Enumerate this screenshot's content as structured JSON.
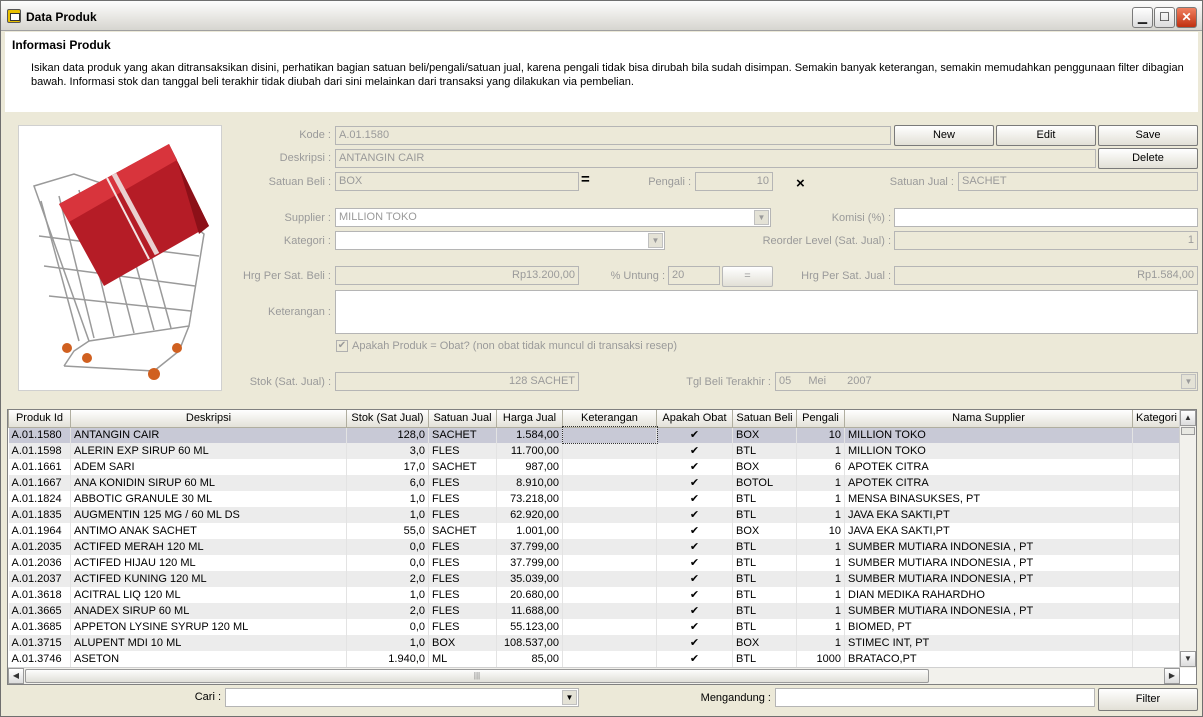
{
  "window": {
    "title": "Data Produk"
  },
  "header": {
    "title": "Informasi Produk",
    "description": "Isikan data produk yang akan ditransaksikan disini, perhatikan bagian satuan beli/pengali/satuan jual, karena pengali tidak bisa dirubah bila sudah disimpan. Semakin banyak keterangan, semakin memudahkan penggunaan filter dibagian bawah. Informasi stok dan tanggal beli terakhir tidak diubah dari sini melainkan dari transaksi yang dilakukan via pembelian."
  },
  "form": {
    "kode_label": "Kode :",
    "kode": "A.01.1580",
    "deskripsi_label": "Deskripsi :",
    "deskripsi": "ANTANGIN CAIR",
    "satuan_beli_label": "Satuan Beli :",
    "satuan_beli": "BOX",
    "equals": "=",
    "pengali_label": "Pengali :",
    "pengali": "10",
    "times": "×",
    "satuan_jual_label": "Satuan Jual :",
    "satuan_jual": "SACHET",
    "supplier_label": "Supplier :",
    "supplier": "MILLION TOKO",
    "komisi_label": "Komisi (%) :",
    "komisi": "",
    "kategori_label": "Kategori :",
    "kategori": "",
    "reorder_label": "Reorder Level (Sat. Jual) :",
    "reorder": "1",
    "hrg_beli_label": "Hrg Per Sat. Beli :",
    "hrg_beli": "Rp13.200,00",
    "untung_label": "% Untung :",
    "untung": "20",
    "calc_label": "=",
    "hrg_jual_label": "Hrg Per Sat. Jual :",
    "hrg_jual": "Rp1.584,00",
    "keterangan_label": "Keterangan :",
    "keterangan": "",
    "obat_check_label": "Apakah Produk = Obat? (non obat tidak muncul di transaksi resep)",
    "stok_label": "Stok (Sat. Jual) :",
    "stok": "128 SACHET",
    "tgl_label": "Tgl Beli Terakhir :",
    "tgl_day": "05",
    "tgl_month": "Mei",
    "tgl_year": "2007"
  },
  "buttons": {
    "new": "New",
    "edit": "Edit",
    "save": "Save",
    "delete": "Delete",
    "filter": "Filter"
  },
  "grid": {
    "columns": [
      "Produk Id",
      "Deskripsi",
      "Stok (Sat Jual)",
      "Satuan Jual",
      "Harga Jual",
      "Keterangan",
      "Apakah Obat",
      "Satuan Beli",
      "Pengali",
      "Nama Supplier",
      "Kategori"
    ],
    "rows": [
      [
        "A.01.1580",
        "ANTANGIN CAIR",
        "128,0",
        "SACHET",
        "1.584,00",
        "",
        "✔",
        "BOX",
        "10",
        "MILLION TOKO",
        ""
      ],
      [
        "A.01.1598",
        "ALERIN EXP SIRUP 60 ML",
        "3,0",
        "FLES",
        "11.700,00",
        "",
        "✔",
        "BTL",
        "1",
        "MILLION TOKO",
        ""
      ],
      [
        "A.01.1661",
        "ADEM SARI",
        "17,0",
        "SACHET",
        "987,00",
        "",
        "✔",
        "BOX",
        "6",
        "APOTEK CITRA",
        ""
      ],
      [
        "A.01.1667",
        "ANA KONIDIN SIRUP 60 ML",
        "6,0",
        "FLES",
        "8.910,00",
        "",
        "✔",
        "BOTOL",
        "1",
        "APOTEK CITRA",
        ""
      ],
      [
        "A.01.1824",
        "ABBOTIC GRANULE 30 ML",
        "1,0",
        "FLES",
        "73.218,00",
        "",
        "✔",
        "BTL",
        "1",
        "MENSA BINASUKSES, PT",
        ""
      ],
      [
        "A.01.1835",
        "AUGMENTIN 125 MG / 60 ML DS",
        "1,0",
        "FLES",
        "62.920,00",
        "",
        "✔",
        "BTL",
        "1",
        "JAVA EKA SAKTI,PT",
        ""
      ],
      [
        "A.01.1964",
        "ANTIMO ANAK SACHET",
        "55,0",
        "SACHET",
        "1.001,00",
        "",
        "✔",
        "BOX",
        "10",
        "JAVA EKA SAKTI,PT",
        ""
      ],
      [
        "A.01.2035",
        "ACTIFED MERAH 120 ML",
        "0,0",
        "FLES",
        "37.799,00",
        "",
        "✔",
        "BTL",
        "1",
        "SUMBER MUTIARA INDONESIA , PT",
        ""
      ],
      [
        "A.01.2036",
        "ACTIFED HIJAU 120 ML",
        "0,0",
        "FLES",
        "37.799,00",
        "",
        "✔",
        "BTL",
        "1",
        "SUMBER MUTIARA INDONESIA , PT",
        ""
      ],
      [
        "A.01.2037",
        "ACTIFED KUNING 120 ML",
        "2,0",
        "FLES",
        "35.039,00",
        "",
        "✔",
        "BTL",
        "1",
        "SUMBER MUTIARA INDONESIA , PT",
        ""
      ],
      [
        "A.01.3618",
        "ACITRAL LIQ 120 ML",
        "1,0",
        "FLES",
        "20.680,00",
        "",
        "✔",
        "BTL",
        "1",
        "DIAN MEDIKA RAHARDHO",
        ""
      ],
      [
        "A.01.3665",
        "ANADEX SIRUP 60 ML",
        "2,0",
        "FLES",
        "11.688,00",
        "",
        "✔",
        "BTL",
        "1",
        "SUMBER MUTIARA INDONESIA , PT",
        ""
      ],
      [
        "A.01.3685",
        "APPETON LYSINE SYRUP 120 ML",
        "0,0",
        "FLES",
        "55.123,00",
        "",
        "✔",
        "BTL",
        "1",
        "BIOMED, PT",
        ""
      ],
      [
        "A.01.3715",
        "ALUPENT MDI 10 ML",
        "1,0",
        "BOX",
        "108.537,00",
        "",
        "✔",
        "BOX",
        "1",
        "STIMEC INT, PT",
        ""
      ],
      [
        "A.01.3746",
        "ASETON",
        "1.940,0",
        "ML",
        "85,00",
        "",
        "✔",
        "BTL",
        "1000",
        "BRATACO,PT",
        ""
      ]
    ]
  },
  "bottom": {
    "cari_label": "Cari :",
    "cari": "",
    "mengandung_label": "Mengandung :",
    "mengandung": ""
  },
  "colors": {
    "selected_row": "#c8c9d6",
    "window_bg": "#ece9d8",
    "product_red": "#c0202a"
  }
}
